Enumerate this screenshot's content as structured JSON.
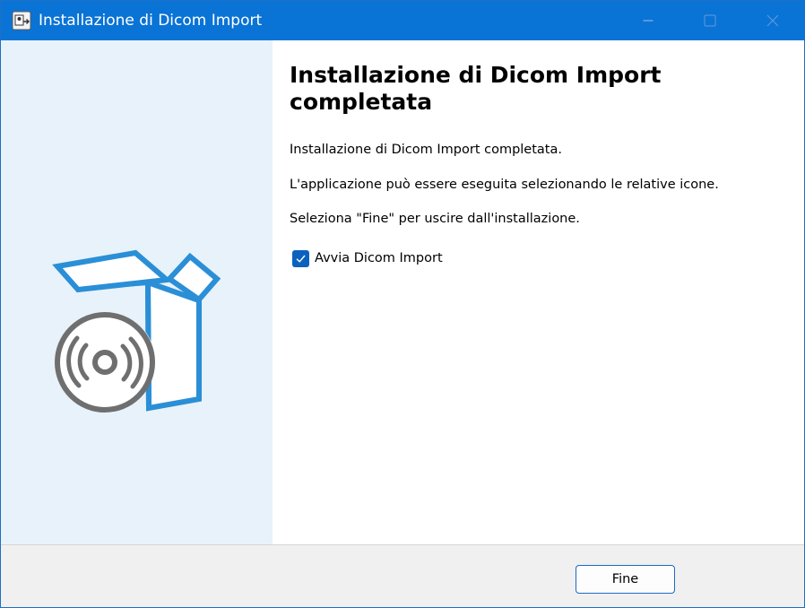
{
  "window": {
    "title": "Installazione di Dicom Import"
  },
  "content": {
    "heading": "Installazione di Dicom Import completata",
    "paragraphs": [
      "Installazione di Dicom Import completata.",
      "L'applicazione può essere eseguita selezionando le relative icone.",
      "Seleziona \"Fine\" per uscire dall'installazione."
    ],
    "launch_checkbox": {
      "label": "Avvia Dicom Import",
      "checked": true
    }
  },
  "footer": {
    "finish_label": "Fine"
  },
  "icons": {
    "app": "installer-app-icon",
    "minimize": "minimize-icon",
    "maximize": "maximize-icon",
    "close": "close-icon",
    "illustration": "software-box-disc-icon",
    "check": "checkmark-icon"
  },
  "colors": {
    "titlebar": "#0a73d6",
    "side_panel": "#e8f2fa",
    "accent": "#1a6bc4",
    "box_outline": "#2a8fd6",
    "disc": "#6f6f6f"
  }
}
